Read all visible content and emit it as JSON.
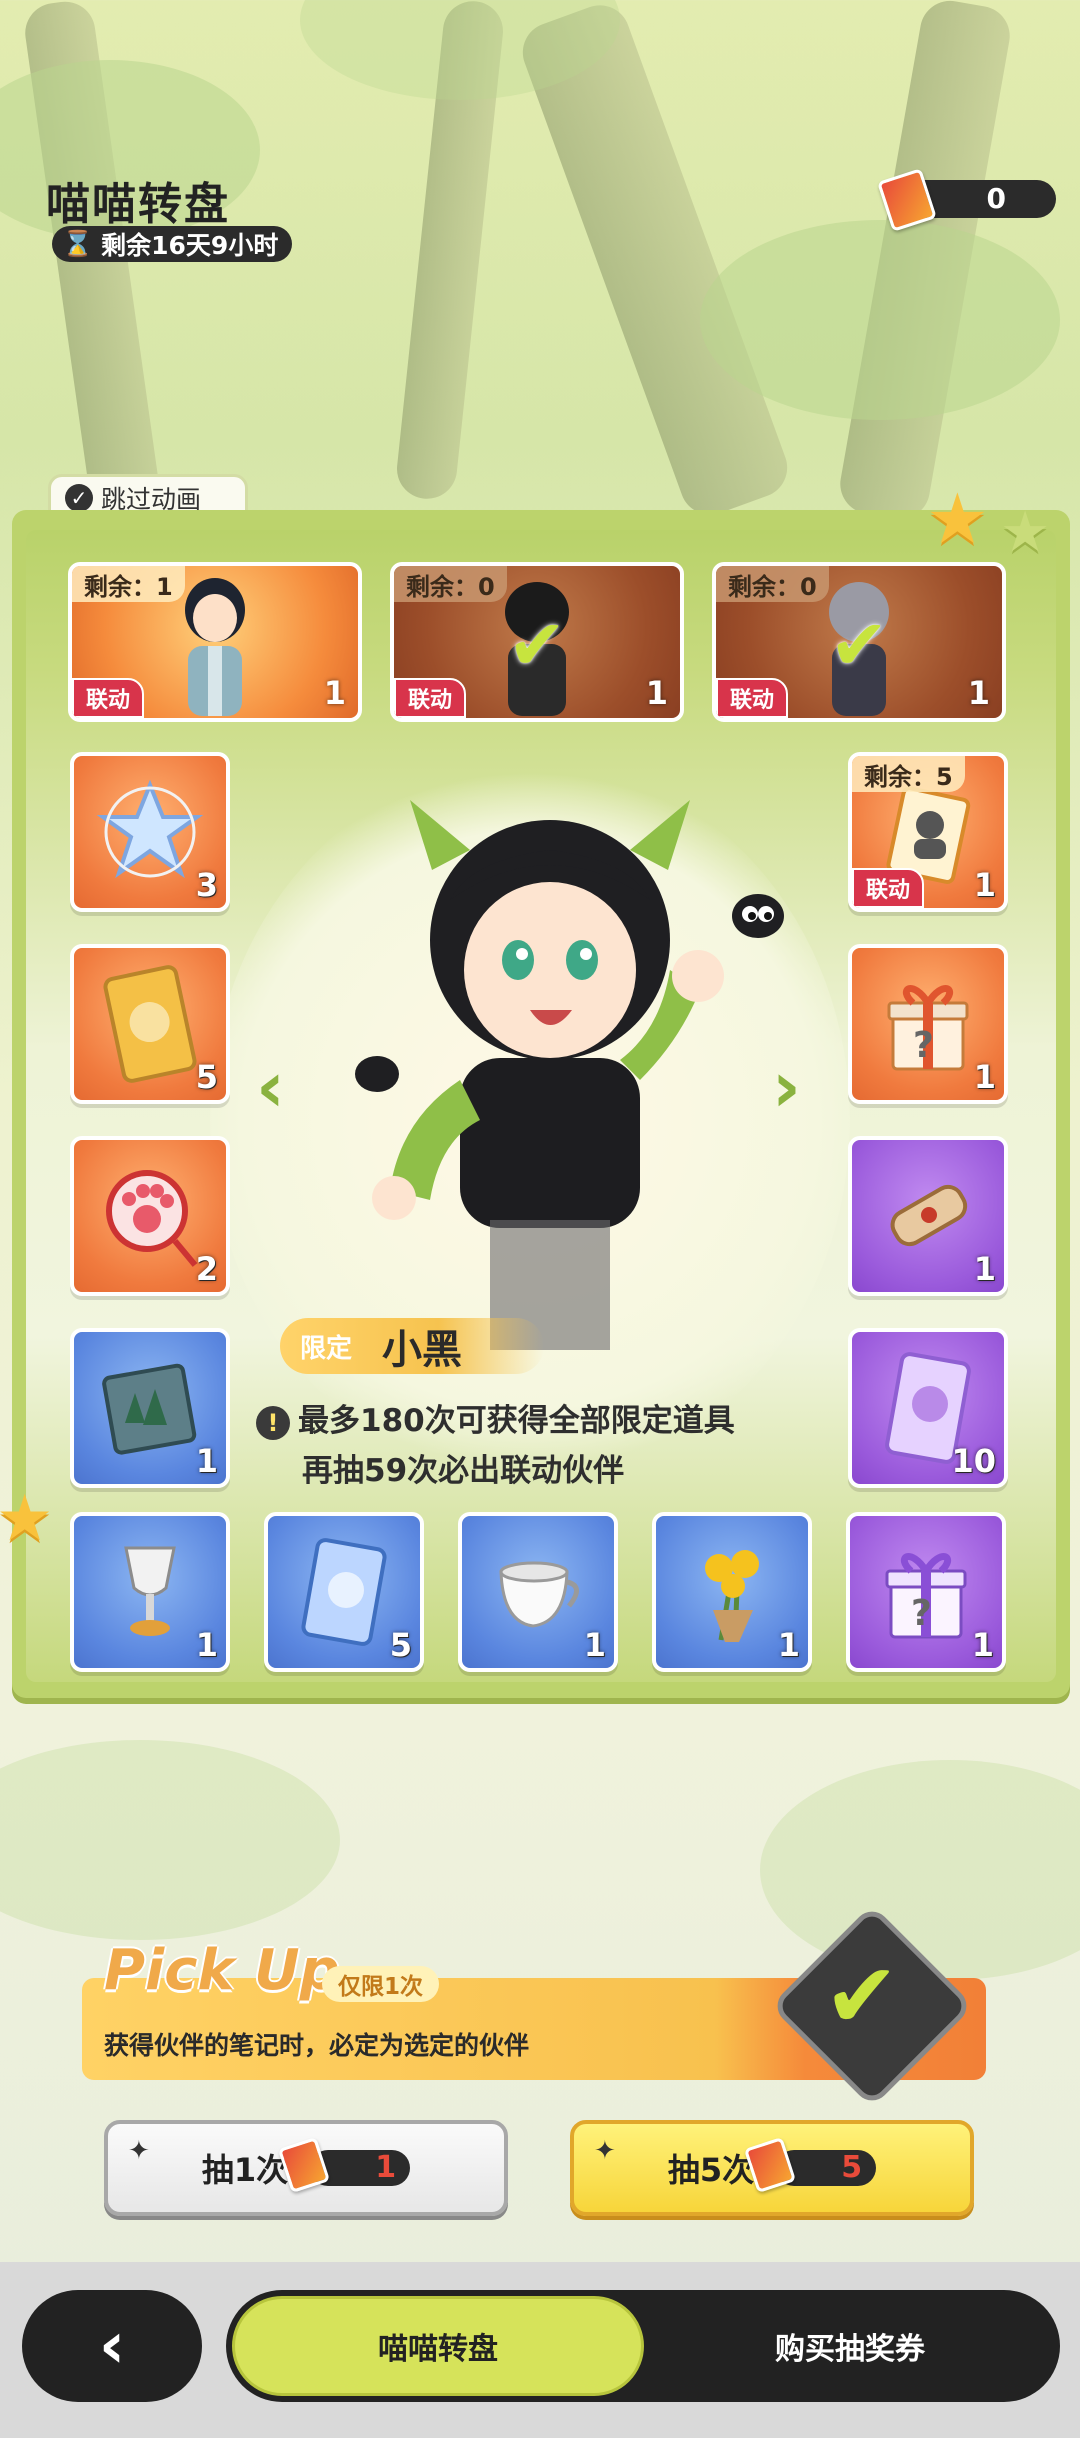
{
  "header": {
    "title": "喵喵转盘",
    "timer": "剩余16天9小时",
    "ticket_count": "0"
  },
  "skip_animation": "跳过动画",
  "featured": [
    {
      "remain": "剩余：1",
      "tag": "联动",
      "count": "1",
      "state": "available"
    },
    {
      "remain": "剩余：0",
      "tag": "联动",
      "count": "1",
      "state": "obtained"
    },
    {
      "remain": "剩余：0",
      "tag": "联动",
      "count": "1",
      "state": "obtained"
    }
  ],
  "left_column": [
    {
      "icon": "crystal-icon",
      "count": "3"
    },
    {
      "icon": "cat-card-icon",
      "count": "5"
    },
    {
      "icon": "paw-mirror-icon",
      "count": "2"
    },
    {
      "icon": "forest-book-icon",
      "count": "1"
    }
  ],
  "right_column": [
    {
      "icon": "mystery-note-icon",
      "remain": "剩余：5",
      "tag": "联动",
      "count": "1"
    },
    {
      "icon": "gift-box-icon",
      "count": "1"
    },
    {
      "icon": "scroll-icon",
      "count": "1"
    },
    {
      "icon": "purple-card-icon",
      "count": "10"
    }
  ],
  "bottom_row": [
    {
      "icon": "goblet-icon",
      "count": "1"
    },
    {
      "icon": "blue-card-icon",
      "count": "5"
    },
    {
      "icon": "teacup-icon",
      "count": "1"
    },
    {
      "icon": "flower-bouquet-icon",
      "count": "1"
    },
    {
      "icon": "purple-gift-icon",
      "count": "1"
    }
  ],
  "center": {
    "limit_label": "限定",
    "name": "小黑",
    "notice_line1": "最多180次可获得全部限定道具",
    "notice_line2": "再抽59次必出联动伙伴"
  },
  "pickup": {
    "title": "Pick Up",
    "tag": "仅限1次",
    "desc": "获得伙伴的笔记时，必定为选定的伙伴"
  },
  "draw": {
    "one": {
      "label": "抽1次",
      "cost": "1"
    },
    "five": {
      "label": "抽5次",
      "cost": "5"
    }
  },
  "nav": {
    "tab_active": "喵喵转盘",
    "tab_other": "购买抽奖券"
  },
  "colors": {
    "accent_green": "#d6e35a",
    "orange_tile": "#f07a3e",
    "purple_tile": "#9b5bdc",
    "blue_tile": "#5a86df",
    "link_red": "#d8344b"
  }
}
